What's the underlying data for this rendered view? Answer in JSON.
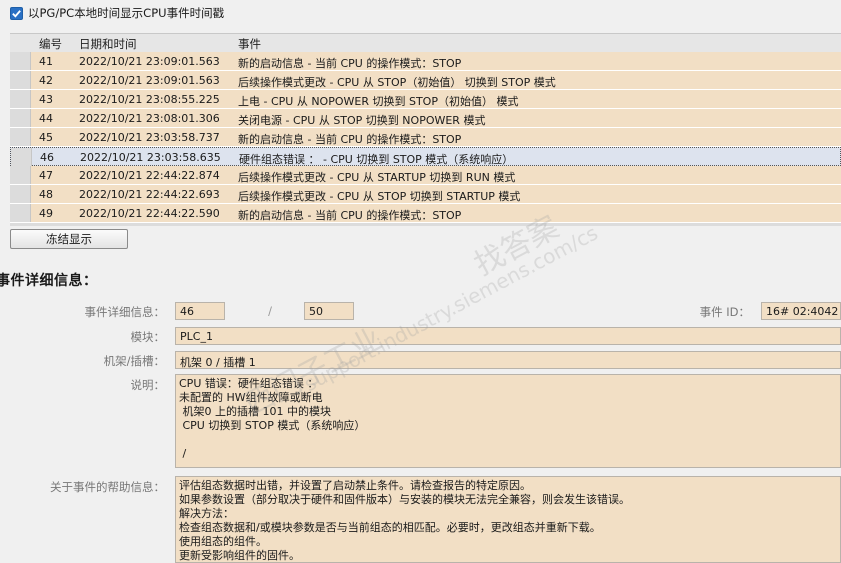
{
  "top_checkbox": {
    "label": "以PG/PC本地时间显示CPU事件时间戳",
    "checked": true
  },
  "table": {
    "headers": [
      "编号",
      "日期和时间",
      "事件"
    ],
    "rows": [
      {
        "num": "41",
        "datetime": "2022/10/21 23:09:01.563",
        "event": "新的启动信息 - 当前 CPU 的操作模式：STOP"
      },
      {
        "num": "42",
        "datetime": "2022/10/21 23:09:01.563",
        "event": "后续操作模式更改 - CPU 从 STOP（初始值） 切换到 STOP 模式"
      },
      {
        "num": "43",
        "datetime": "2022/10/21 23:08:55.225",
        "event": "上电 - CPU 从 NOPOWER 切换到 STOP（初始值） 模式"
      },
      {
        "num": "44",
        "datetime": "2022/10/21 23:08:01.306",
        "event": "关闭电源 - CPU 从 STOP 切换到 NOPOWER 模式"
      },
      {
        "num": "45",
        "datetime": "2022/10/21 23:03:58.737",
        "event": "新的启动信息 - 当前 CPU 的操作模式：STOP"
      },
      {
        "num": "46",
        "datetime": "2022/10/21 23:03:58.635",
        "event": "硬件组态错误 ： - CPU 切换到 STOP 模式（系统响应）",
        "selected": true
      },
      {
        "num": "47",
        "datetime": "2022/10/21 22:44:22.874",
        "event": "后续操作模式更改 - CPU 从 STARTUP 切换到 RUN 模式"
      },
      {
        "num": "48",
        "datetime": "2022/10/21 22:44:22.693",
        "event": "后续操作模式更改 - CPU 从 STOP 切换到 STARTUP 模式"
      },
      {
        "num": "49",
        "datetime": "2022/10/21 22:44:22.590",
        "event": "新的启动信息 - 当前 CPU 的操作模式：STOP"
      }
    ]
  },
  "freeze_button": "冻结显示",
  "details": {
    "title": "事件详细信息：",
    "info_label": "事件详细信息：",
    "current": "46",
    "separator": "/",
    "total": "50",
    "event_id_label": "事件 ID：",
    "event_id": "16# 02:4042",
    "module_label": "模块：",
    "module": "PLC_1",
    "rack_label": "机架/插槽：",
    "rack": "机架 0 / 插槽 1",
    "desc_label": "说明：",
    "description": "CPU 错误：硬件组态错误 ：\n未配置的 HW组件故障或断电\n 机架0 上的插槽 101 中的模块\n CPU 切换到 STOP 模式（系统响应）\n\n /",
    "help_label": "关于事件的帮助信息：",
    "help": "评估组态数据时出错，并设置了启动禁止条件。请检查报告的特定原因。\n如果参数设置（部分取决于硬件和固件版本）与安装的模块无法完全兼容，则会发生该错误。\n解决方法：\n检查组态数据和/或模块参数是否与当前组态的相匹配。必要时，更改组态并重新下载。\n使用组态的组件。\n更新受影响组件的固件。"
  },
  "watermarks": [
    "西门子工业",
    "support.industry.siemens.com/cs",
    "找答案"
  ]
}
